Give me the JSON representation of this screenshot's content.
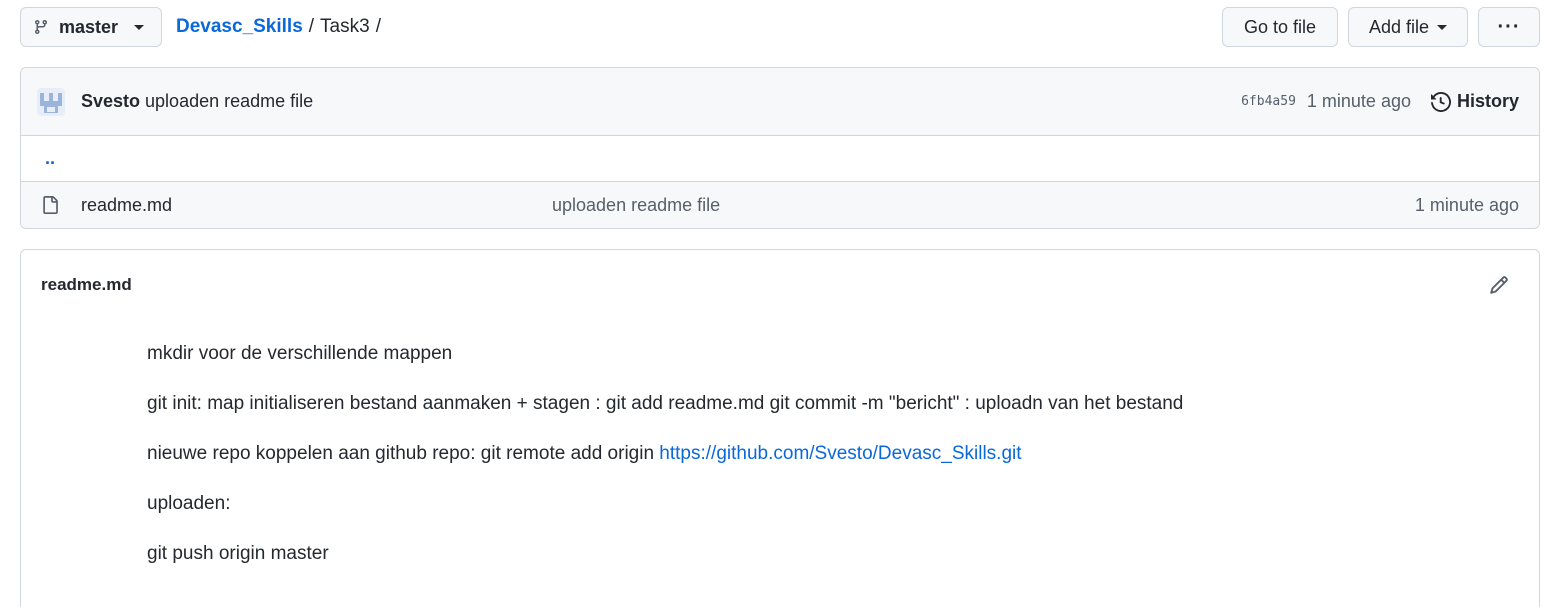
{
  "branch": {
    "name": "master"
  },
  "breadcrumb": {
    "repo": "Devasc_Skills",
    "sep1": "/",
    "folder": "Task3",
    "sep2": "/"
  },
  "toolbar": {
    "goto_label": "Go to file",
    "add_label": "Add file",
    "more_label": "···"
  },
  "commit": {
    "author": "Svesto",
    "message": "uploaden readme file",
    "sha": "6fb4a59",
    "time": "1 minute ago",
    "history_label": "History"
  },
  "files": {
    "parent_label": "..",
    "items": [
      {
        "name": "readme.md",
        "message": "uploaden readme file",
        "time": "1 minute ago"
      }
    ]
  },
  "readme": {
    "title": "readme.md",
    "line1": "mkdir voor de verschillende mappen",
    "line2": "git init: map initialiseren bestand aanmaken + stagen : git add readme.md git commit -m \"bericht\" : uploadn van het bestand",
    "line3_text": "nieuwe repo koppelen aan github repo: git remote add origin ",
    "line3_link": "https://github.com/Svesto/Devasc_Skills.git",
    "line4": "uploaden:",
    "line5": "git push origin master"
  },
  "colors": {
    "link": "#0969da",
    "border": "#d0d7de",
    "muted": "#57606a",
    "header_bg": "#f6f8fa"
  }
}
